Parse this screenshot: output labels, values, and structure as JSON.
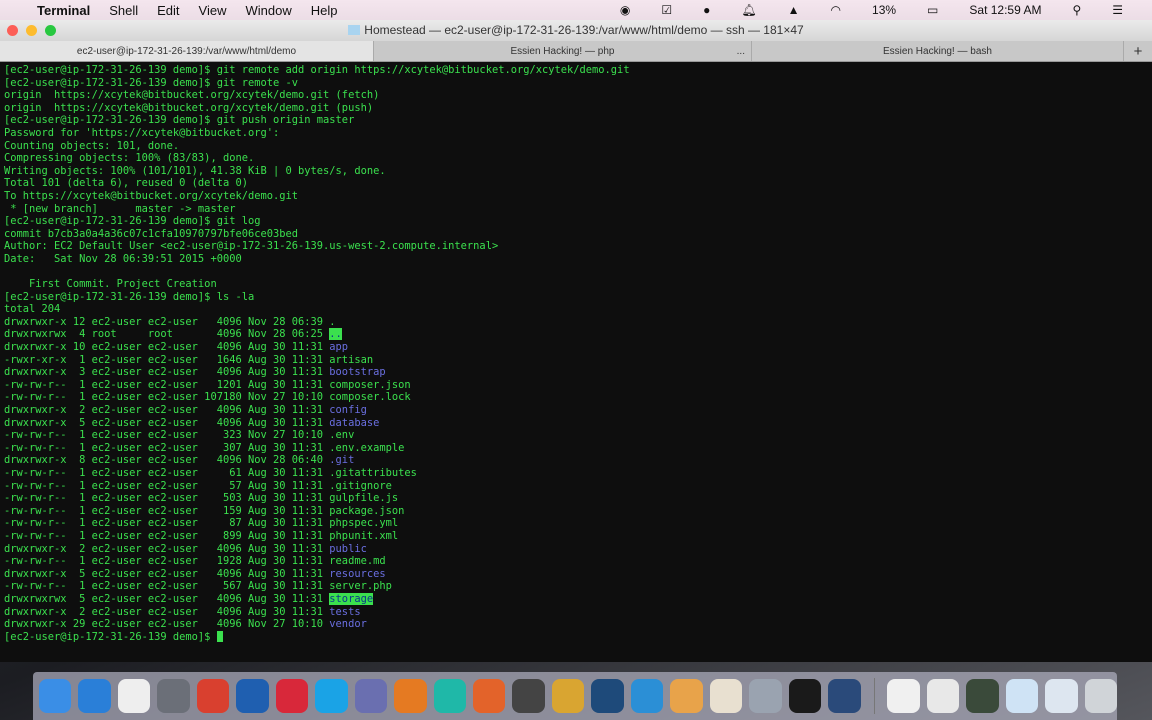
{
  "menubar": {
    "app": "Terminal",
    "items": [
      "Shell",
      "Edit",
      "View",
      "Window",
      "Help"
    ],
    "battery": "13%",
    "clock": "Sat 12:59 AM"
  },
  "window": {
    "title": "Homestead — ec2-user@ip-172-31-26-139:/var/www/html/demo — ssh — 181×47",
    "tabs": [
      {
        "label": "ec2-user@ip-172-31-26-139:/var/www/html/demo"
      },
      {
        "label": "Essien Hacking! — php"
      },
      {
        "label": "Essien Hacking! — bash"
      }
    ],
    "tab_more": "...",
    "new_tab": "+"
  },
  "terminal": {
    "lines": [
      "[ec2-user@ip-172-31-26-139 demo]$ git remote add origin https://xcytek@bitbucket.org/xcytek/demo.git",
      "[ec2-user@ip-172-31-26-139 demo]$ git remote -v",
      "origin  https://xcytek@bitbucket.org/xcytek/demo.git (fetch)",
      "origin  https://xcytek@bitbucket.org/xcytek/demo.git (push)",
      "[ec2-user@ip-172-31-26-139 demo]$ git push origin master",
      "Password for 'https://xcytek@bitbucket.org':",
      "Counting objects: 101, done.",
      "Compressing objects: 100% (83/83), done.",
      "Writing objects: 100% (101/101), 41.38 KiB | 0 bytes/s, done.",
      "Total 101 (delta 6), reused 0 (delta 0)",
      "To https://xcytek@bitbucket.org/xcytek/demo.git",
      " * [new branch]      master -> master",
      "[ec2-user@ip-172-31-26-139 demo]$ git log",
      "commit b7cb3a0a4a36c07c1cfa10970797bfe06ce03bed",
      "Author: EC2 Default User <ec2-user@ip-172-31-26-139.us-west-2.compute.internal>",
      "Date:   Sat Nov 28 06:39:51 2015 +0000",
      "",
      "    First Commit. Project Creation",
      "[ec2-user@ip-172-31-26-139 demo]$ ls -la",
      "total 204"
    ],
    "listing": [
      {
        "meta": "drwxrwxr-x 12 ec2-user ec2-user   4096 Nov 28 06:39 ",
        "name": ".",
        "type": "file"
      },
      {
        "meta": "drwxrwxrwx  4 root     root       4096 Nov 28 06:25 ",
        "name": "..",
        "type": "hl"
      },
      {
        "meta": "drwxrwxr-x 10 ec2-user ec2-user   4096 Aug 30 11:31 ",
        "name": "app",
        "type": "dir"
      },
      {
        "meta": "-rwxr-xr-x  1 ec2-user ec2-user   1646 Aug 30 11:31 ",
        "name": "artisan",
        "type": "file"
      },
      {
        "meta": "drwxrwxr-x  3 ec2-user ec2-user   4096 Aug 30 11:31 ",
        "name": "bootstrap",
        "type": "dir"
      },
      {
        "meta": "-rw-rw-r--  1 ec2-user ec2-user   1201 Aug 30 11:31 ",
        "name": "composer.json",
        "type": "file"
      },
      {
        "meta": "-rw-rw-r--  1 ec2-user ec2-user 107180 Nov 27 10:10 ",
        "name": "composer.lock",
        "type": "file"
      },
      {
        "meta": "drwxrwxr-x  2 ec2-user ec2-user   4096 Aug 30 11:31 ",
        "name": "config",
        "type": "dir"
      },
      {
        "meta": "drwxrwxr-x  5 ec2-user ec2-user   4096 Aug 30 11:31 ",
        "name": "database",
        "type": "dir"
      },
      {
        "meta": "-rw-rw-r--  1 ec2-user ec2-user    323 Nov 27 10:10 ",
        "name": ".env",
        "type": "file"
      },
      {
        "meta": "-rw-rw-r--  1 ec2-user ec2-user    307 Aug 30 11:31 ",
        "name": ".env.example",
        "type": "file"
      },
      {
        "meta": "drwxrwxr-x  8 ec2-user ec2-user   4096 Nov 28 06:40 ",
        "name": ".git",
        "type": "dir"
      },
      {
        "meta": "-rw-rw-r--  1 ec2-user ec2-user     61 Aug 30 11:31 ",
        "name": ".gitattributes",
        "type": "file"
      },
      {
        "meta": "-rw-rw-r--  1 ec2-user ec2-user     57 Aug 30 11:31 ",
        "name": ".gitignore",
        "type": "file"
      },
      {
        "meta": "-rw-rw-r--  1 ec2-user ec2-user    503 Aug 30 11:31 ",
        "name": "gulpfile.js",
        "type": "file"
      },
      {
        "meta": "-rw-rw-r--  1 ec2-user ec2-user    159 Aug 30 11:31 ",
        "name": "package.json",
        "type": "file"
      },
      {
        "meta": "-rw-rw-r--  1 ec2-user ec2-user     87 Aug 30 11:31 ",
        "name": "phpspec.yml",
        "type": "file"
      },
      {
        "meta": "-rw-rw-r--  1 ec2-user ec2-user    899 Aug 30 11:31 ",
        "name": "phpunit.xml",
        "type": "file"
      },
      {
        "meta": "drwxrwxr-x  2 ec2-user ec2-user   4096 Aug 30 11:31 ",
        "name": "public",
        "type": "dir"
      },
      {
        "meta": "-rw-rw-r--  1 ec2-user ec2-user   1928 Aug 30 11:31 ",
        "name": "readme.md",
        "type": "file"
      },
      {
        "meta": "drwxrwxr-x  5 ec2-user ec2-user   4096 Aug 30 11:31 ",
        "name": "resources",
        "type": "dir"
      },
      {
        "meta": "-rw-rw-r--  1 ec2-user ec2-user    567 Aug 30 11:31 ",
        "name": "server.php",
        "type": "file"
      },
      {
        "meta": "drwxrwxrwx  5 ec2-user ec2-user   4096 Aug 30 11:31 ",
        "name": "storage",
        "type": "hl"
      },
      {
        "meta": "drwxrwxr-x  2 ec2-user ec2-user   4096 Aug 30 11:31 ",
        "name": "tests",
        "type": "dir"
      },
      {
        "meta": "drwxrwxr-x 29 ec2-user ec2-user   4096 Nov 27 10:10 ",
        "name": "vendor",
        "type": "dir"
      }
    ],
    "prompt": "[ec2-user@ip-172-31-26-139 demo]$ "
  },
  "dock": [
    {
      "icon": "finder-icon",
      "color": "#3a8ee6"
    },
    {
      "icon": "safari-icon",
      "color": "#2a7fd8"
    },
    {
      "icon": "launchpad-grid-icon",
      "color": "#eeeeee"
    },
    {
      "icon": "rocket-icon",
      "color": "#6b6f78"
    },
    {
      "icon": "chrome-icon",
      "color": "#d9402f"
    },
    {
      "icon": "firefox-icon",
      "color": "#1f5fb0"
    },
    {
      "icon": "vivaldi-icon",
      "color": "#d8283a"
    },
    {
      "icon": "skype-icon",
      "color": "#1aa3e6"
    },
    {
      "icon": "php-icon",
      "color": "#6a6fb0"
    },
    {
      "icon": "sublime-s-icon",
      "color": "#e57a22"
    },
    {
      "icon": "webstorm-icon",
      "color": "#1fb8a8"
    },
    {
      "icon": "sourcetree-icon",
      "color": "#e3632a"
    },
    {
      "icon": "sublime-text-icon",
      "color": "#444444"
    },
    {
      "icon": "sequel-pro-icon",
      "color": "#d9a531"
    },
    {
      "icon": "sourcetree-tree-icon",
      "color": "#1e4a7a"
    },
    {
      "icon": "bolt-icon",
      "color": "#2b8fd6"
    },
    {
      "icon": "photos-icon",
      "color": "#e8a34a"
    },
    {
      "icon": "popcorn-icon",
      "color": "#e8e0d0"
    },
    {
      "icon": "system-preferences-icon",
      "color": "#9aa3b0"
    },
    {
      "icon": "terminal-icon",
      "color": "#1a1a1a"
    },
    {
      "icon": "quicktime-icon",
      "color": "#2a4a7a"
    },
    {
      "icon": "pdf-document-icon",
      "color": "#f0f0f0"
    },
    {
      "icon": "jpeg-document-icon",
      "color": "#e8e8e8"
    },
    {
      "icon": "screenshot-icon",
      "color": "#3a4a3a"
    },
    {
      "icon": "screenshot-icon",
      "color": "#cfe3f5"
    },
    {
      "icon": "screenshot-icon",
      "color": "#dde6f0"
    },
    {
      "icon": "trash-icon",
      "color": "#d0d4d8"
    }
  ]
}
